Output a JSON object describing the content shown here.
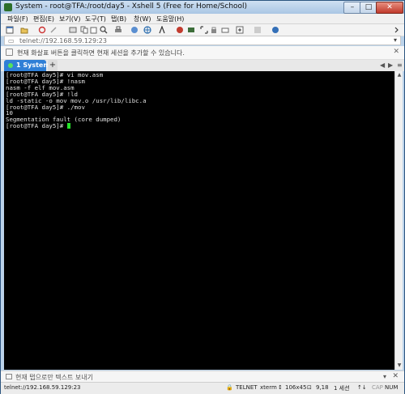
{
  "window": {
    "title": "System - root@TFA:/root/day5 - Xshell 5 (Free for Home/School)",
    "close_glyph": "✕",
    "min_glyph": "–",
    "max_glyph": "□"
  },
  "menu": [
    "파일(F)",
    "편집(E)",
    "보기(V)",
    "도구(T)",
    "탭(B)",
    "창(W)",
    "도움말(H)"
  ],
  "address": {
    "value": "telnet://192.168.59.129:23"
  },
  "infobar": {
    "text": "현재 화살표 버튼을 클릭하면 현재 세션을 추가할 수 있습니다.",
    "close_glyph": "✕"
  },
  "tabs": {
    "active_label": "1 System",
    "add_glyph": "+",
    "prev_glyph": "◀",
    "next_glyph": "▶",
    "menu_glyph": "≡"
  },
  "terminal": {
    "lines": [
      "[root@TFA day5]# vi mov.asm",
      "[root@TFA day5]# !nasm",
      "nasm -f elf mov.asm",
      "[root@TFA day5]# !ld",
      "ld -static -o mov mov.o /usr/lib/libc.a",
      "[root@TFA day5]# ./mov",
      "10",
      "Segmentation fault (core dumped)"
    ],
    "prompt": "[root@TFA day5]# "
  },
  "compose": {
    "text": "현재 탭으로만 텍스트 보내기",
    "menu_glyph": "▾",
    "close_glyph": "✕"
  },
  "status": {
    "connection": "telnet://192.168.59.129:23",
    "protocol": "TELNET",
    "terminal_type": "xterm",
    "size": "106x45",
    "cursor_pos": "9,18",
    "sessions": "1 세션",
    "cap": "CAP",
    "num": "NUM"
  },
  "colors": {
    "tab_active": "#2f7fd6",
    "cursor": "#25e42a",
    "terminal_bg": "#000000"
  }
}
